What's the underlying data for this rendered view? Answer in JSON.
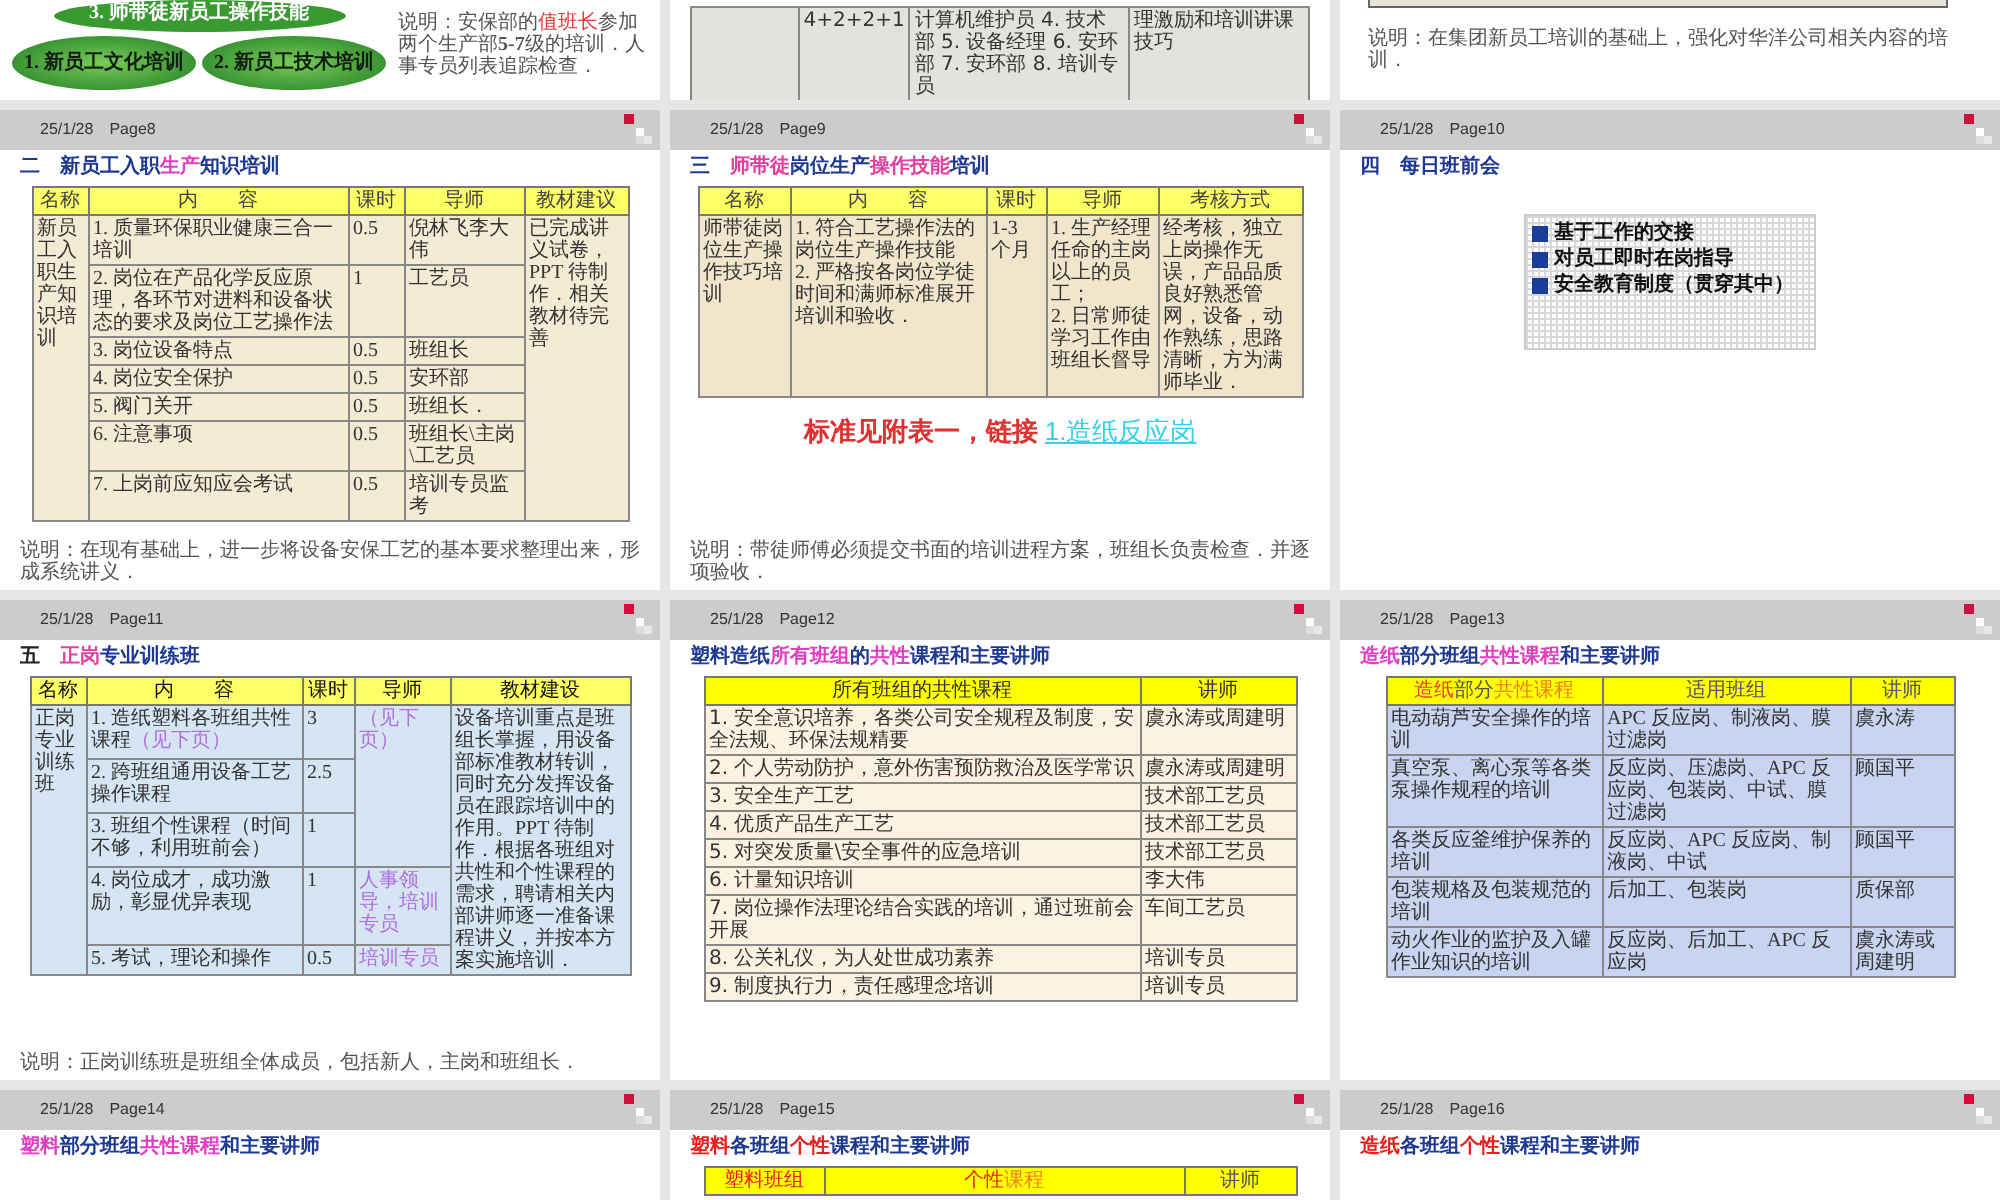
{
  "slides": [
    {
      "kind": "ovals",
      "ovals": [
        "3. 师带徒新员工操作技能",
        "1. 新员工文化培训",
        "2. 新员工技术培训"
      ],
      "note": [
        {
          "text": "说明：安保部的"
        },
        {
          "text": "值班长",
          "color": "#e83838"
        },
        {
          "text": "参加两个生产部"
        },
        {
          "text": "5-7",
          "bold": true
        },
        {
          "text": "级的培训．人事专员列表追踪检查．"
        }
      ]
    },
    {
      "kind": "table",
      "table": {
        "rows": [
          [
            {},
            {
              "text": "4+2+2+1"
            },
            {
              "text": "计算机维护员 4. 技术部 5. 设备经理 6. 安环部 7. 安环部 8. 培训专员"
            },
            {
              "text": "理激励和培训讲课技巧"
            }
          ]
        ]
      }
    },
    {
      "kind": "table-end",
      "note": [
        {
          "text": "说明：在集团新员工培训的基础上，强化对华洋公司相关内容的培训．"
        }
      ]
    },
    {
      "kind": "table",
      "date": "25/1/28",
      "page": "Page8",
      "title": [
        {
          "text": "二　新员工入职",
          "color": "#1f3a93"
        },
        {
          "text": "生产",
          "color": "#e040c0"
        },
        {
          "text": "知识培训",
          "color": "#1f3a93"
        }
      ],
      "table": {
        "columns": [
          "名称",
          "内　　容",
          "课时",
          "导师",
          "教材建议"
        ],
        "rows": [
          [
            {
              "text": "新员工入职生产知识培训",
              "rowspan": 7
            },
            {
              "text": "1. 质量环保职业健康三合一培训"
            },
            {
              "text": "0.5"
            },
            {
              "text": "倪林飞李大伟"
            },
            {
              "text": "已完成讲义试卷，PPT 待制作．相关教材待完善",
              "rowspan": 7
            }
          ],
          [
            {
              "text": "2. 岗位在产品化学反应原理，各环节对进料和设备状态的要求及岗位工艺操作法"
            },
            {
              "text": "1"
            },
            {
              "text": "工艺员"
            }
          ],
          [
            {
              "text": "3. 岗位设备特点"
            },
            {
              "text": "0.5"
            },
            {
              "text": "班组长"
            }
          ],
          [
            {
              "text": "4. 岗位安全保护"
            },
            {
              "text": "0.5"
            },
            {
              "text": "安环部"
            }
          ],
          [
            {
              "text": "5. 阀门关开"
            },
            {
              "text": "0.5"
            },
            {
              "text": "班组长．"
            }
          ],
          [
            {
              "text": "6. 注意事项"
            },
            {
              "text": "0.5"
            },
            {
              "text": "班组长\\主岗\\工艺员"
            }
          ],
          [
            {
              "text": "7. 上岗前应知应会考试"
            },
            {
              "text": "0.5"
            },
            {
              "text": "培训专员监考"
            }
          ]
        ]
      },
      "note": [
        {
          "text": "说明：在现有基础上，进一步将设备安保工艺的基本要求整理出来，形成系统讲义．"
        }
      ]
    },
    {
      "kind": "table",
      "date": "25/1/28",
      "page": "Page9",
      "title": [
        {
          "text": "三　",
          "color": "#1f3a93"
        },
        {
          "text": "师带徒",
          "color": "#e040a0"
        },
        {
          "text": "岗位生产",
          "color": "#1f3a93"
        },
        {
          "text": "操作技能",
          "color": "#e040a0"
        },
        {
          "text": "培训",
          "color": "#1f3a93"
        }
      ],
      "table": {
        "columns": [
          "名称",
          "内　　容",
          "课时",
          "导师",
          "考核方式"
        ],
        "rows": [
          [
            {
              "text": "师带徒岗位生产操作技巧培训"
            },
            {
              "text": "1. 符合工艺操作法的岗位生产操作技能\n2. 严格按各岗位学徒时间和满师标准展开培训和验收．"
            },
            {
              "text": "1-3 个月"
            },
            {
              "text": "1. 生产经理任命的主岗以上的员工；\n2. 日常师徒学习工作由班组长督导"
            },
            {
              "text": "经考核，独立上岗操作无误，产品品质良好熟悉管网，设备，动作熟练，思路清晰，方为满师毕业．"
            }
          ]
        ]
      },
      "reference": {
        "text": "标准见附表一，链接",
        "link": "1.造纸反应岗"
      },
      "note": [
        {
          "text": "说明：带徒师傅必须提交书面的培训进程方案，班组长负责检查．并逐项验收．"
        }
      ]
    },
    {
      "kind": "bullets",
      "date": "25/1/28",
      "page": "Page10",
      "title": [
        {
          "text": "四　每日班前会",
          "color": "#1f3a93"
        }
      ],
      "bullets": [
        "基于工作的交接",
        "对员工即时在岗指导",
        "安全教育制度（贯穿其中）"
      ]
    },
    {
      "kind": "table",
      "date": "25/1/28",
      "page": "Page11",
      "title": [
        {
          "text": "五　",
          "color": "#222222"
        },
        {
          "text": "正岗",
          "color": "#e040a0"
        },
        {
          "text": "专业训练班",
          "color": "#1f3a93"
        }
      ],
      "table": {
        "columns": [
          "名称",
          "内　　容",
          "课时",
          "导师",
          "教材建设"
        ],
        "rows": [
          [
            {
              "text": "正岗专业训练班",
              "rowspan": 5
            },
            {
              "text": [
                {
                  "text": "1. 造纸塑料各班组共性课程"
                },
                {
                  "text": "（见下页）",
                  "color": "#b070e0"
                }
              ]
            },
            {
              "text": "3"
            },
            {
              "text": "（见下页）",
              "color": "#b070e0",
              "rowspan": 3
            },
            {
              "text": "设备培训重点是班组长掌握，用设备部标准教材转训，同时充分发挥设备员在跟踪培训中的作用。PPT 待制作．根据各班组对共性和个性课程的需求，聘请相关内部讲师逐一准备课程讲义，并按本方案实施培训．",
              "rowspan": 5
            }
          ],
          [
            {
              "text": "2. 跨班组通用设备工艺操作课程"
            },
            {
              "text": "2.5"
            }
          ],
          [
            {
              "text": "3. 班组个性课程（时间不够，利用班前会）"
            },
            {
              "text": "1"
            }
          ],
          [
            {
              "text": "4. 岗位成才，成功激励，彰显优异表现"
            },
            {
              "text": "1"
            },
            {
              "text": "人事领导，培训专员",
              "color": "#b070e0"
            }
          ],
          [
            {
              "text": "5. 考试，理论和操作"
            },
            {
              "text": "0.5"
            },
            {
              "text": "培训专员",
              "color": "#b070e0"
            }
          ]
        ]
      },
      "note": [
        {
          "text": "说明：正岗训练班是班组全体成员，包括新人，主岗和班组长．"
        }
      ]
    },
    {
      "kind": "table",
      "date": "25/1/28",
      "page": "Page12",
      "title": [
        {
          "text": "塑料造纸",
          "color": "#1f3a93"
        },
        {
          "text": "所有班组",
          "color": "#e040c0"
        },
        {
          "text": "的",
          "color": "#1f3a93"
        },
        {
          "text": "共性",
          "color": "#e040c0"
        },
        {
          "text": "课程和主要讲师",
          "color": "#1f3a93"
        }
      ],
      "table": {
        "columns": [
          "所有班组的共性课程",
          "讲师"
        ],
        "rows": [
          [
            {
              "text": "1. 安全意识培养，各类公司安全规程及制度，安全法规、环保法规精要"
            },
            {
              "text": "虞永涛或周建明"
            }
          ],
          [
            {
              "text": "2. 个人劳动防护，意外伤害预防救治及医学常识"
            },
            {
              "text": "虞永涛或周建明"
            }
          ],
          [
            {
              "text": "3. 安全生产工艺"
            },
            {
              "text": "技术部工艺员"
            }
          ],
          [
            {
              "text": "4. 优质产品生产工艺"
            },
            {
              "text": "技术部工艺员"
            }
          ],
          [
            {
              "text": "5. 对突发质量\\安全事件的应急培训"
            },
            {
              "text": "技术部工艺员"
            }
          ],
          [
            {
              "text": "6. 计量知识培训"
            },
            {
              "text": "李大伟"
            }
          ],
          [
            {
              "text": "7. 岗位操作法理论结合实践的培训，通过班前会开展"
            },
            {
              "text": "车间工艺员"
            }
          ],
          [
            {
              "text": "8. 公关礼仪，为人处世成功素养"
            },
            {
              "text": "培训专员"
            }
          ],
          [
            {
              "text": "9. 制度执行力，责任感理念培训"
            },
            {
              "text": "培训专员"
            }
          ]
        ]
      }
    },
    {
      "kind": "table",
      "date": "25/1/28",
      "page": "Page13",
      "title": [
        {
          "text": "造纸",
          "color": "#e040c0"
        },
        {
          "text": "部分班组",
          "color": "#1f3a93"
        },
        {
          "text": "共性课程",
          "color": "#e040c0"
        },
        {
          "text": "和主要讲师",
          "color": "#1f3a93"
        }
      ],
      "table": {
        "columns": [
          [
            {
              "text": "造纸",
              "color": "#e84030"
            },
            {
              "text": "部分",
              "color": "#555555"
            },
            {
              "text": "共性课程",
              "color": "#f08020"
            }
          ],
          "适用班组",
          "讲师"
        ],
        "rows": [
          [
            {
              "text": "电动葫芦安全操作的培训"
            },
            {
              "text": "APC 反应岗、制液岗、膜过滤岗"
            },
            {
              "text": "虞永涛"
            }
          ],
          [
            {
              "text": "真空泵、离心泵等各类泵操作规程的培训"
            },
            {
              "text": "反应岗、压滤岗、APC 反应岗、包装岗、中试、膜过滤岗"
            },
            {
              "text": "顾国平"
            }
          ],
          [
            {
              "text": "各类反应釜维护保养的培训"
            },
            {
              "text": "反应岗、APC 反应岗、制液岗、中试"
            },
            {
              "text": "顾国平"
            }
          ],
          [
            {
              "text": "包装规格及包装规范的培训"
            },
            {
              "text": "后加工、包装岗"
            },
            {
              "text": "质保部"
            }
          ],
          [
            {
              "text": "动火作业的监护及入罐作业知识的培训"
            },
            {
              "text": "反应岗、后加工、APC 反应岗"
            },
            {
              "text": "虞永涛或周建明"
            }
          ]
        ]
      }
    },
    {
      "kind": "title-only",
      "date": "25/1/28",
      "page": "Page14",
      "title": [
        {
          "text": "塑料",
          "color": "#e040c0"
        },
        {
          "text": "部分班组",
          "color": "#1f3a93"
        },
        {
          "text": "共性课程",
          "color": "#e040c0"
        },
        {
          "text": "和主要讲师",
          "color": "#1f3a93"
        }
      ]
    },
    {
      "kind": "table",
      "date": "25/1/28",
      "page": "Page15",
      "title": [
        {
          "text": "塑料",
          "color": "#e82020"
        },
        {
          "text": "各班组",
          "color": "#1f3a93"
        },
        {
          "text": "个性",
          "color": "#e82020"
        },
        {
          "text": "课程和主要讲师",
          "color": "#1f3a93"
        }
      ],
      "table": {
        "columns": [
          [
            {
              "text": "塑料班组",
              "color": "#e82020"
            }
          ],
          [
            {
              "text": "个性",
              "color": "#e82020"
            },
            {
              "text": "课程",
              "color": "#f08020"
            }
          ],
          "讲师"
        ]
      }
    },
    {
      "kind": "title-only",
      "date": "25/1/28",
      "page": "Page16",
      "title": [
        {
          "text": "造纸",
          "color": "#e82020"
        },
        {
          "text": "各班组",
          "color": "#1f3a93"
        },
        {
          "text": "个性",
          "color": "#e82020"
        },
        {
          "text": "课程和主要讲师",
          "color": "#1f3a93"
        }
      ]
    }
  ]
}
